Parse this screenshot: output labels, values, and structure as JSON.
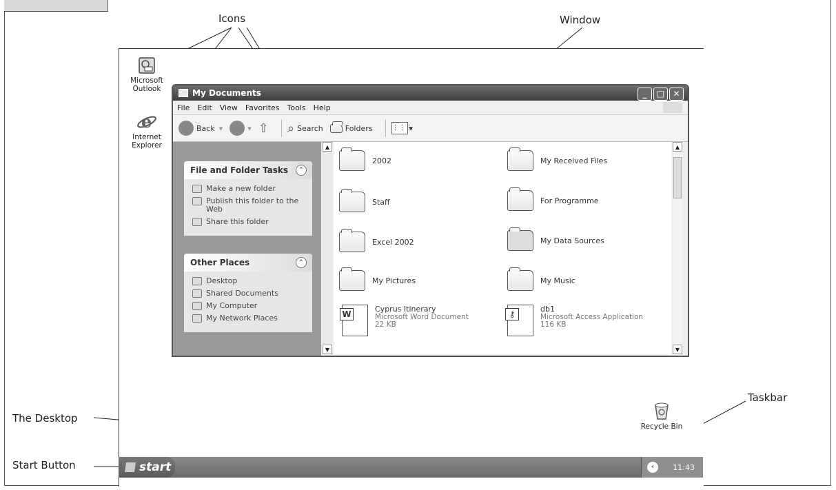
{
  "callouts": {
    "icons": "Icons",
    "window": "Window",
    "taskbar": "Taskbar",
    "desktop": "The Desktop",
    "start_button": "Start Button"
  },
  "desktop_icons": [
    {
      "label": "Microsoft Outlook",
      "icon": "outlook-icon"
    },
    {
      "label": "Internet Explorer",
      "icon": "internet-explorer-icon"
    },
    {
      "label": "Recycle Bin",
      "icon": "recycle-bin-icon"
    }
  ],
  "window": {
    "title": "My Documents",
    "menu": [
      "File",
      "Edit",
      "View",
      "Favorites",
      "Tools",
      "Help"
    ],
    "toolbar": {
      "back": "Back",
      "search": "Search",
      "folders": "Folders"
    },
    "panels": [
      {
        "title": "File and Folder Tasks",
        "items": [
          "Make a new folder",
          "Publish this folder to the Web",
          "Share this folder"
        ]
      },
      {
        "title": "Other Places",
        "items": [
          "Desktop",
          "Shared Documents",
          "My Computer",
          "My Network Places"
        ]
      }
    ],
    "items": [
      {
        "name": "2002",
        "icon": "folder-icon"
      },
      {
        "name": "My Received Files",
        "icon": "folder-icon"
      },
      {
        "name": "Staff",
        "icon": "folder-icon"
      },
      {
        "name": "For Programme",
        "icon": "folder-icon"
      },
      {
        "name": "Excel 2002",
        "icon": "folder-icon"
      },
      {
        "name": "My Data Sources",
        "icon": "data-sources-folder-icon"
      },
      {
        "name": "My Pictures",
        "icon": "pictures-folder-icon"
      },
      {
        "name": "My Music",
        "icon": "music-folder-icon"
      },
      {
        "name": "Cyprus Itinerary",
        "type": "Microsoft Word Document",
        "size": "22 KB",
        "icon": "word-document-icon"
      },
      {
        "name": "db1",
        "type": "Microsoft Access Application",
        "size": "116 KB",
        "icon": "access-database-icon"
      }
    ]
  },
  "taskbar": {
    "start_label": "start",
    "clock": "11:43"
  }
}
